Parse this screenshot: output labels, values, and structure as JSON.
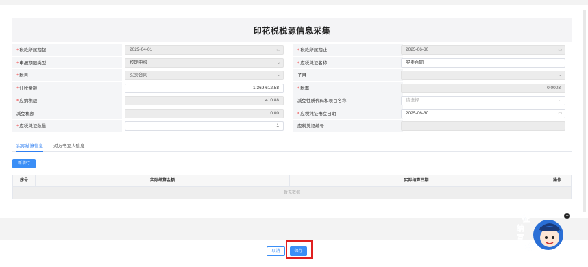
{
  "form": {
    "title": "印花税税源信息采集",
    "rows": [
      {
        "l_label": "税款所属期起",
        "l_req": true,
        "l_value": "2025-04-01",
        "l_suffix": "▭",
        "l_disabled": true,
        "r_label": "税款所属期止",
        "r_req": true,
        "r_value": "2025-06-30",
        "r_suffix": "▭",
        "r_disabled": true
      },
      {
        "l_label": "申报期限类型",
        "l_req": true,
        "l_value": "按期申报",
        "l_suffix": "⌄",
        "l_disabled": true,
        "r_label": "应税凭证名称",
        "r_req": true,
        "r_value": "买卖合同",
        "r_suffix": "",
        "r_disabled": false
      },
      {
        "l_label": "税目",
        "l_req": true,
        "l_value": "买卖合同",
        "l_suffix": "⌄",
        "l_disabled": true,
        "r_label": "子目",
        "r_req": false,
        "r_value": "",
        "r_suffix": "⌄",
        "r_disabled": true
      },
      {
        "l_label": "计税金额",
        "l_req": true,
        "l_value": "1,369,612.58",
        "l_suffix": "",
        "l_disabled": false,
        "l_num": true,
        "r_label": "税率",
        "r_req": true,
        "r_value": "0.0003",
        "r_suffix": "",
        "r_disabled": true,
        "r_num": true
      },
      {
        "l_label": "应纳税额",
        "l_req": true,
        "l_value": "410.88",
        "l_suffix": "",
        "l_disabled": true,
        "l_num": true,
        "r_label": "减免性质代码和项目名称",
        "r_req": false,
        "r_value": "",
        "r_placeholder": "请选择",
        "r_suffix": "⌄",
        "r_disabled": false
      },
      {
        "l_label": "减免税额",
        "l_req": false,
        "l_value": "0.00",
        "l_suffix": "",
        "l_disabled": true,
        "l_num": true,
        "r_label": "应税凭证书立日期",
        "r_req": true,
        "r_value": "2025-06-30",
        "r_suffix": "▭",
        "r_disabled": false
      },
      {
        "l_label": "应税凭证数量",
        "l_req": true,
        "l_value": "1",
        "l_suffix": "",
        "l_disabled": false,
        "l_num": true,
        "r_label": "应税凭证编号",
        "r_req": false,
        "r_value": "",
        "r_suffix": "",
        "r_disabled": true
      }
    ]
  },
  "tabs": [
    {
      "label": "实际结算信息",
      "active": true
    },
    {
      "label": "对方书立人信息",
      "active": false
    }
  ],
  "add_row_label": "新增行",
  "table": {
    "headers": [
      "序号",
      "实际结算金额",
      "实际结算日期",
      "操作"
    ],
    "empty_text": "暂无数据"
  },
  "footer": {
    "cancel_label": "取消",
    "save_label": "保存"
  },
  "assistant": {
    "chars": [
      "征",
      "纳",
      "互",
      "动"
    ],
    "close_label": "−"
  },
  "colors": {
    "accent": "#3a8ef6",
    "required": "#e44444",
    "highlight": "#e02020"
  }
}
